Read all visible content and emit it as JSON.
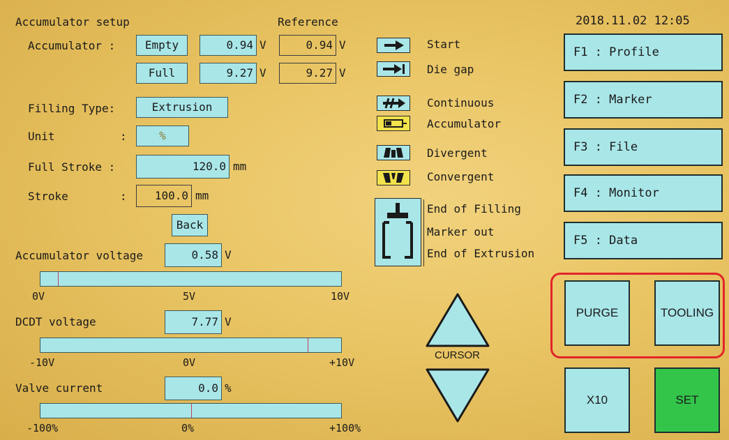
{
  "datetime": "2018.11.02 12:05",
  "accumulator_setup": {
    "title": "Accumulator setup",
    "reference_header": "Reference",
    "accumulator_label": "Accumulator :",
    "empty_button": "Empty",
    "empty_value": "0.94",
    "empty_reference": "0.94",
    "full_button": "Full",
    "full_value": "9.27",
    "full_reference": "9.27",
    "unit_v": "V",
    "filling_type_label": "Filling Type:",
    "filling_type_value": "Extrusion",
    "unit_label": "Unit",
    "unit_colon": ":",
    "unit_value": "%",
    "full_stroke_label": "Full Stroke :",
    "full_stroke_value": "120.0",
    "full_stroke_unit": "mm",
    "stroke_label": "Stroke",
    "stroke_colon": ":",
    "stroke_value": "100.0",
    "stroke_unit": "mm",
    "back_button": "Back"
  },
  "accumulator_voltage": {
    "label": "Accumulator voltage",
    "value": "0.58",
    "unit": "V",
    "level_fraction": 0.058,
    "ticks": [
      "0V",
      "5V",
      "10V"
    ]
  },
  "dcdt_voltage": {
    "label": "DCDT voltage",
    "value": "7.77",
    "unit": "V",
    "level_fraction": 0.8885,
    "ticks": [
      "-10V",
      "0V",
      "+10V"
    ]
  },
  "valve_current": {
    "label": "Valve current",
    "value": "0.0",
    "unit": "%",
    "level_fraction": 0.5,
    "ticks": [
      "-100%",
      "0%",
      "+100%"
    ]
  },
  "legend": {
    "start": "Start",
    "die_gap": "Die gap",
    "continuous": "Continuous",
    "accumulator": "Accumulator",
    "divergent": "Divergent",
    "convergent": "Convergent",
    "end_of_filling": "End of Filling",
    "marker_out": "Marker out",
    "end_of_extrusion": "End of Extrusion"
  },
  "cursor_label": "CURSOR",
  "function_keys": {
    "f1": "F1 : Profile",
    "f2": "F2 : Marker",
    "f3": "F3 : File",
    "f4": "F4 : Monitor",
    "f5": "F5 : Data"
  },
  "buttons": {
    "purge": "PURGE",
    "tooling": "TOOLING",
    "x10": "X10",
    "set": "SET"
  },
  "colors": {
    "panel_cyan": "#a9e6e8",
    "set_green": "#33c54a",
    "highlight_red": "#e2252a",
    "icon_yellow": "#f2e24b",
    "background_amber": "#e9c463"
  }
}
